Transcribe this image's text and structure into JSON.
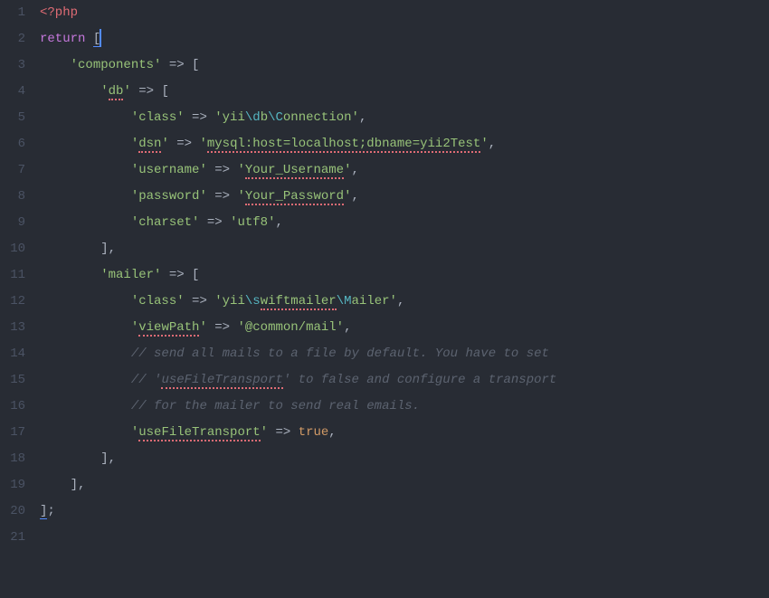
{
  "lineNumbers": [
    "1",
    "2",
    "3",
    "4",
    "5",
    "6",
    "7",
    "8",
    "9",
    "10",
    "11",
    "12",
    "13",
    "14",
    "15",
    "16",
    "17",
    "18",
    "19",
    "20",
    "21"
  ],
  "tokens": {
    "l1_phpopen": "<?php",
    "l2_return": "return",
    "l2_brk": "[",
    "l3_key": "'components'",
    "l3_arrow": " => ",
    "l3_brk": "[",
    "l4_key": "'",
    "l4_key_txt": "db",
    "l4_key2": "'",
    "l4_arrow": " => ",
    "l4_brk": "[",
    "l5_key": "'class'",
    "l5_arrow": " => ",
    "l5_val_open": "'",
    "l5_val_txt": "yii",
    "l5_esc1": "\\d",
    "l5_val_txt2": "b",
    "l5_esc2": "\\C",
    "l5_val_txt3": "onnection",
    "l5_val_close": "'",
    "l5_comma": ",",
    "l6_key": "'",
    "l6_key_txt": "dsn",
    "l6_key2": "'",
    "l6_arrow": " => ",
    "l6_val_open": "'",
    "l6_val_txt": "mysql:host=localhost;dbname=yii2Test",
    "l6_val_close": "'",
    "l6_comma": ",",
    "l7_key": "'username'",
    "l7_arrow": " => ",
    "l7_val_open": "'",
    "l7_val_txt": "Your_Username",
    "l7_val_close": "'",
    "l7_comma": ",",
    "l8_key": "'password'",
    "l8_arrow": " => ",
    "l8_val_open": "'",
    "l8_val_txt": "Your_Password",
    "l8_val_close": "'",
    "l8_comma": ",",
    "l9_key": "'charset'",
    "l9_arrow": " => ",
    "l9_val": "'utf8'",
    "l9_comma": ",",
    "l10_brk": "],",
    "l11_key": "'mailer'",
    "l11_arrow": " => ",
    "l11_brk": "[",
    "l12_key": "'class'",
    "l12_arrow": " => ",
    "l12_val_open": "'",
    "l12_val_txt": "yii",
    "l12_esc1": "\\s",
    "l12_val_txt2": "wiftmailer",
    "l12_esc2": "\\M",
    "l12_val_txt3": "ailer",
    "l12_val_close": "'",
    "l12_comma": ",",
    "l13_key_open": "'",
    "l13_key_txt": "viewPath",
    "l13_key_close": "'",
    "l13_arrow": " => ",
    "l13_val": "'@common/mail'",
    "l13_comma": ",",
    "l14_cmt": "// send all mails to a file by default. You have to set",
    "l15_cmt_open": "// '",
    "l15_cmt_err": "useFileTransport",
    "l15_cmt_rest": "' to false and configure a transport",
    "l16_cmt": "// for the mailer to send real emails.",
    "l17_key_open": "'",
    "l17_key_txt": "useFileTransport",
    "l17_key_close": "'",
    "l17_arrow": " => ",
    "l17_val": "true",
    "l17_comma": ",",
    "l18_brk": "],",
    "l19_brk": "],",
    "l20_brk": "]",
    "l20_semi": ";"
  }
}
